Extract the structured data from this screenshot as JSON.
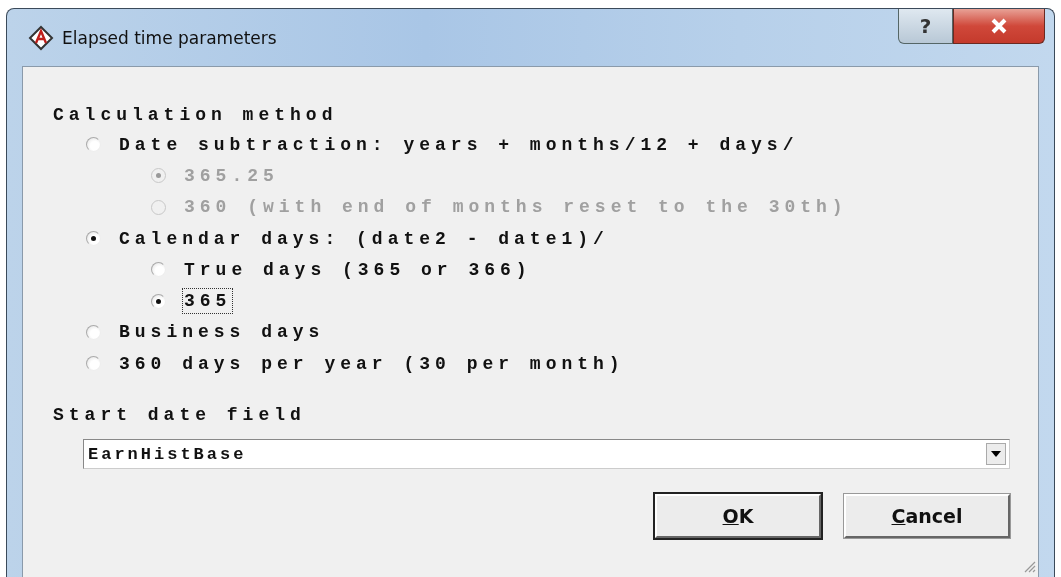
{
  "window": {
    "title": "Elapsed time parameters",
    "help_button": "?"
  },
  "calculation_method": {
    "heading": "Calculation method",
    "options": [
      {
        "label": "Date subtraction: years + months/12 + days/",
        "selected": false,
        "disabled": false,
        "focused": false,
        "children": [
          {
            "label": "365.25",
            "selected": true,
            "disabled": true,
            "focused": false
          },
          {
            "label": "360 (with end of months reset to the 30th)",
            "selected": false,
            "disabled": true,
            "focused": false
          }
        ]
      },
      {
        "label": "Calendar days: (date2 - date1)/",
        "selected": true,
        "disabled": false,
        "focused": false,
        "children": [
          {
            "label": "True days (365 or 366)",
            "selected": false,
            "disabled": false,
            "focused": false
          },
          {
            "label": "365",
            "selected": true,
            "disabled": false,
            "focused": true
          }
        ]
      },
      {
        "label": "Business days",
        "selected": false,
        "disabled": false,
        "focused": false
      },
      {
        "label": "360 days per year (30 per month)",
        "selected": false,
        "disabled": false,
        "focused": false
      }
    ]
  },
  "start_date": {
    "label": "Start date field",
    "value": "EarnHistBase"
  },
  "buttons": [
    {
      "label": "OK",
      "kind": "default"
    },
    {
      "label": "Cancel",
      "kind": "normal"
    }
  ]
}
